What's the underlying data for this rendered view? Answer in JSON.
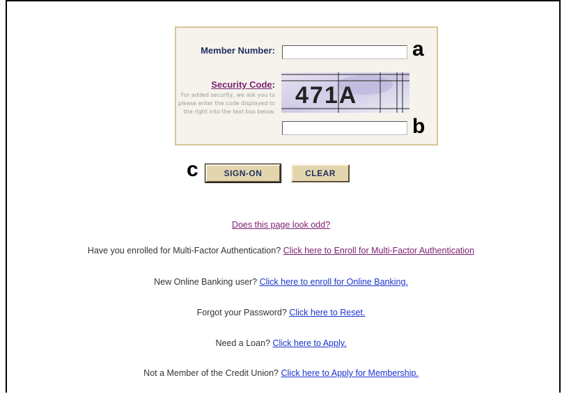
{
  "login": {
    "member_label": "Member Number:",
    "member_value": "",
    "security_label": "Security Code",
    "security_colon": ":",
    "security_help": "For added security, we ask you to please enter the code displayed to the right into the text box below.",
    "captcha_text": "471A",
    "code_value": ""
  },
  "markers": {
    "a": "a",
    "b": "b",
    "c": "c"
  },
  "buttons": {
    "signon": "SIGN-ON",
    "clear": "CLEAR"
  },
  "links": {
    "odd": "Does this page look odd?",
    "mfa_text": "Have you enrolled for Multi-Factor Authentication?",
    "mfa_link": "Click here to Enroll for Multi-Factor Authentication",
    "enroll_text": "New Online Banking user?",
    "enroll_link": "Click here to enroll for Online Banking.",
    "reset_text": "Forgot your Password?",
    "reset_link": "Click here to Reset.",
    "loan_text": "Need a Loan?",
    "loan_link": "Click here to Apply.",
    "member_text": "Not a Member of the Credit Union?",
    "member_link": "Click here to Apply for Membership."
  },
  "colors": {
    "box_bg": "#f5f3ec",
    "box_border": "#d6c69a",
    "button": "#e3d6ae",
    "link": "#1a34cc",
    "visited": "#7a1e72"
  }
}
